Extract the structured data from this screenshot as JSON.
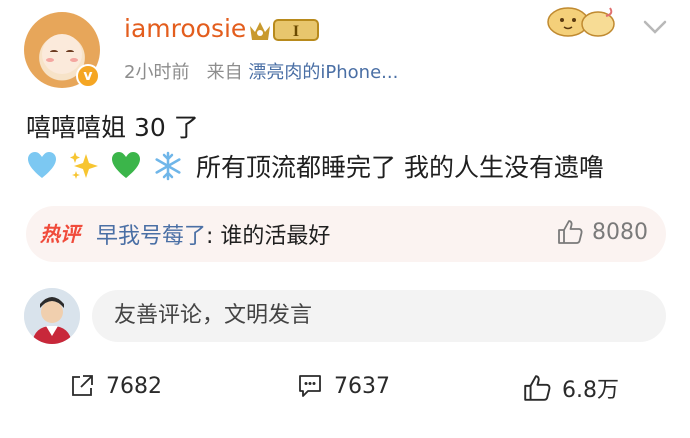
{
  "post": {
    "username": "iamroosie",
    "vip_level": "I",
    "meta_time": "2小时前",
    "meta_source_prefix": "来自",
    "meta_source": "漂亮肉的iPhone...",
    "text_line1": "嘻嘻嘻姐 30 了",
    "emojis": [
      "light-blue-heart",
      "sparkles",
      "green-heart",
      "snowflake"
    ],
    "text_line2": "所有顶流都睡完了 我的人生没有遗噜"
  },
  "hot_comment": {
    "label": "热评",
    "commenter": "早我号莓了",
    "separator": ":",
    "text": " 谁的活最好",
    "likes": "8080"
  },
  "comment_box": {
    "placeholder": "友善评论，文明发言"
  },
  "actions": {
    "reposts": "7682",
    "comments": "7637",
    "likes": "6.8万"
  },
  "colors": {
    "username": "#e35d1d",
    "link": "#4a6fa5",
    "hot_label": "#f04b3b"
  }
}
